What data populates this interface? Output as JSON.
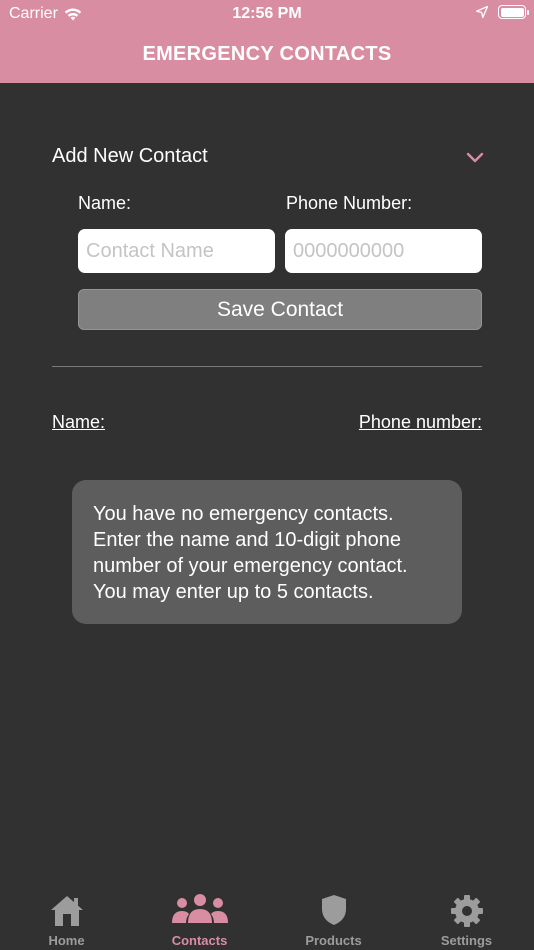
{
  "status_bar": {
    "carrier": "Carrier",
    "time": "12:56 PM"
  },
  "header": {
    "title": "EMERGENCY CONTACTS",
    "background": "#d98da3"
  },
  "add_contact": {
    "title": "Add New Contact",
    "name_label": "Name:",
    "phone_label": "Phone Number:",
    "name_placeholder": "Contact Name",
    "name_value": "",
    "phone_placeholder": "0000000000",
    "phone_value": "",
    "save_label": "Save Contact"
  },
  "contacts_list": {
    "name_header": "Name:",
    "phone_header": "Phone number:",
    "empty_message": "You have no emergency contacts. Enter the name and 10-digit phone number of your emergency contact. You may enter up to 5 contacts."
  },
  "tabs": [
    {
      "label": "Home",
      "icon": "home-icon",
      "active": false
    },
    {
      "label": "Contacts",
      "icon": "people-icon",
      "active": true
    },
    {
      "label": "Products",
      "icon": "shield-icon",
      "active": false
    },
    {
      "label": "Settings",
      "icon": "gear-icon",
      "active": false
    }
  ],
  "colors": {
    "accent": "#d98da3",
    "background": "#313131",
    "inactive_tab": "#9c9c9c"
  }
}
